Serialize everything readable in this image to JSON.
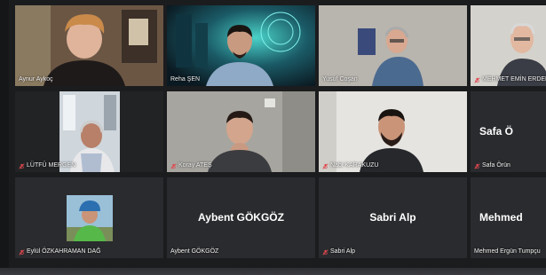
{
  "window": {
    "accent": "#e9e46d",
    "tile_bg": "#2a2b2e",
    "muted_mic_color": "#e0484f"
  },
  "participants": [
    {
      "name": "Aynur Aykoç",
      "muted": false,
      "video": true,
      "active": false
    },
    {
      "name": "Reha ŞEN",
      "muted": false,
      "video": true,
      "active": true
    },
    {
      "name": "Yusuf Coşan",
      "muted": false,
      "video": true,
      "active": false
    },
    {
      "name": "MEHMET EMİN ERDEM",
      "muted": true,
      "video": true,
      "active": false
    },
    {
      "name": "LÜTFÜ MERGEN",
      "muted": true,
      "video": true,
      "active": false
    },
    {
      "name": "Koray ATEŞ",
      "muted": true,
      "video": true,
      "active": false
    },
    {
      "name": "Nabi KARAKUZU",
      "muted": true,
      "video": true,
      "active": false
    },
    {
      "name": "Safa Örün",
      "muted": true,
      "video": false,
      "active": false,
      "display_name": "Safa Ö"
    },
    {
      "name": "Eylül ÖZKAHRAMAN DAĞ",
      "muted": true,
      "video": true,
      "active": false
    },
    {
      "name": "Aybent GÖKGÖZ",
      "muted": false,
      "video": false,
      "active": false,
      "display_name": "Aybent GÖKGÖZ"
    },
    {
      "name": "Sabri Alp",
      "muted": true,
      "video": false,
      "active": false,
      "display_name": "Sabri Alp"
    },
    {
      "name": "Mehmed Ergün Tumpçu",
      "muted": false,
      "video": false,
      "active": false,
      "display_name": "Mehmed"
    }
  ],
  "icons": {
    "muted_mic": "microphone-muted-icon"
  }
}
